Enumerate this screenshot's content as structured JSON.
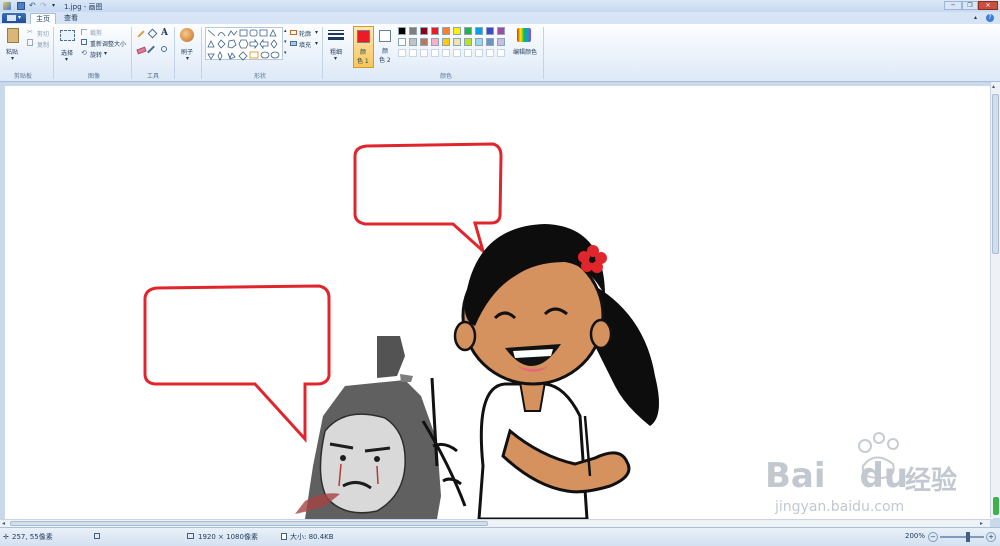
{
  "window": {
    "title": "1.jpg - 画图",
    "controls": [
      "─",
      "❐",
      "✕"
    ]
  },
  "tabs": [
    {
      "label": "主页",
      "active": true
    },
    {
      "label": "查看",
      "active": false
    }
  ],
  "ribbon": {
    "clipboard": {
      "paste": "粘贴",
      "cut": "剪切",
      "copy": "复制",
      "group": "剪贴板"
    },
    "image": {
      "select": "选择",
      "crop": "裁剪",
      "resize": "重新调整大小",
      "rotate": "旋转",
      "group": "图像"
    },
    "tools": {
      "group": "工具"
    },
    "brushes": {
      "label": "刷子"
    },
    "shapes": {
      "outline": "轮廓",
      "fill": "填充",
      "group": "形状"
    },
    "size": {
      "label": "粗细"
    },
    "color1": {
      "label1": "颜",
      "label2": "色 1"
    },
    "color2": {
      "label1": "颜",
      "label2": "色 2"
    },
    "edit_colors": "编辑颜色",
    "colors_group": "颜色",
    "palette": [
      "#000000",
      "#7f7f7f",
      "#880015",
      "#ed1c24",
      "#ff7f27",
      "#fff200",
      "#22b14c",
      "#00a2e8",
      "#3f48cc",
      "#a349a4",
      "#ffffff",
      "#c3c3c3",
      "#b97a57",
      "#ffaec9",
      "#ffc90e",
      "#efe4b0",
      "#b5e61d",
      "#99d9ea",
      "#7092be",
      "#c8bfe7"
    ],
    "color1_value": "#ed1c24",
    "color2_value": "#ffffff"
  },
  "status": {
    "cursor_pos": "257, 55像素",
    "image_size": "1920 × 1080像素",
    "file_size": "大小: 80.4KB",
    "zoom": "200%"
  },
  "watermark": {
    "brand": "Bai",
    "brand2": "du",
    "cn": "经验",
    "url": "jingyan.baidu.com"
  }
}
